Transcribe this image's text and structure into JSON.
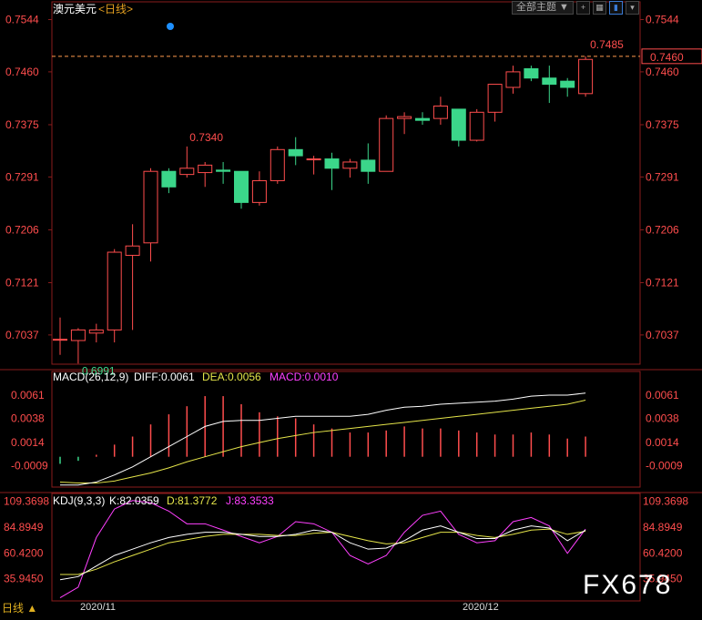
{
  "app": {
    "symbol_label": "澳元美元",
    "period_label": "<日线>",
    "theme_label": "全部主题",
    "corner_period": "日线",
    "watermark": "FX678"
  },
  "colors": {
    "up": "#ff4d4d",
    "down": "#3bd68a",
    "axis_text": "#ff4d4d",
    "grid": "#8a1c1c",
    "diff": "#ffffff",
    "dea": "#e5e54a",
    "macd": "#ff40ff",
    "k": "#ffffff",
    "d": "#e5e54a",
    "j": "#ff40ff",
    "last_price_line": "#ff9a4d",
    "marker_dot": "#1e90ff"
  },
  "chart_data": {
    "type": "candlestick",
    "price_panel": {
      "y_ticks": [
        "0.7544",
        "0.7460",
        "0.7375",
        "0.7291",
        "0.7206",
        "0.7121",
        "0.7037"
      ],
      "ylim": [
        0.699,
        0.7555
      ],
      "high_label": "0.7340",
      "low_label": "0.6991",
      "last_high_label": "0.7485",
      "last_price_label": "0.7460",
      "candles": [
        {
          "o": 0.703,
          "h": 0.7065,
          "l": 0.7005,
          "c": 0.703
        },
        {
          "o": 0.7028,
          "h": 0.7048,
          "l": 0.6991,
          "c": 0.7045
        },
        {
          "o": 0.704,
          "h": 0.7055,
          "l": 0.7025,
          "c": 0.7045
        },
        {
          "o": 0.7045,
          "h": 0.7175,
          "l": 0.7025,
          "c": 0.717
        },
        {
          "o": 0.7165,
          "h": 0.7215,
          "l": 0.7045,
          "c": 0.718
        },
        {
          "o": 0.7185,
          "h": 0.7305,
          "l": 0.7155,
          "c": 0.73
        },
        {
          "o": 0.73,
          "h": 0.7305,
          "l": 0.7265,
          "c": 0.7275
        },
        {
          "o": 0.7295,
          "h": 0.734,
          "l": 0.729,
          "c": 0.7305
        },
        {
          "o": 0.7298,
          "h": 0.7315,
          "l": 0.7275,
          "c": 0.731
        },
        {
          "o": 0.7302,
          "h": 0.7315,
          "l": 0.728,
          "c": 0.73
        },
        {
          "o": 0.73,
          "h": 0.73,
          "l": 0.724,
          "c": 0.725
        },
        {
          "o": 0.725,
          "h": 0.73,
          "l": 0.7245,
          "c": 0.7285
        },
        {
          "o": 0.7285,
          "h": 0.734,
          "l": 0.728,
          "c": 0.7335
        },
        {
          "o": 0.7335,
          "h": 0.7355,
          "l": 0.731,
          "c": 0.7325
        },
        {
          "o": 0.732,
          "h": 0.7325,
          "l": 0.7295,
          "c": 0.732
        },
        {
          "o": 0.732,
          "h": 0.733,
          "l": 0.727,
          "c": 0.7305
        },
        {
          "o": 0.7305,
          "h": 0.732,
          "l": 0.729,
          "c": 0.7315
        },
        {
          "o": 0.7318,
          "h": 0.7345,
          "l": 0.728,
          "c": 0.73
        },
        {
          "o": 0.73,
          "h": 0.739,
          "l": 0.73,
          "c": 0.7385
        },
        {
          "o": 0.7385,
          "h": 0.7395,
          "l": 0.736,
          "c": 0.7388
        },
        {
          "o": 0.7385,
          "h": 0.7395,
          "l": 0.7375,
          "c": 0.7382
        },
        {
          "o": 0.7385,
          "h": 0.742,
          "l": 0.7375,
          "c": 0.7405
        },
        {
          "o": 0.74,
          "h": 0.74,
          "l": 0.734,
          "c": 0.735
        },
        {
          "o": 0.735,
          "h": 0.74,
          "l": 0.7348,
          "c": 0.7395
        },
        {
          "o": 0.7395,
          "h": 0.744,
          "l": 0.738,
          "c": 0.744
        },
        {
          "o": 0.7435,
          "h": 0.747,
          "l": 0.7425,
          "c": 0.746
        },
        {
          "o": 0.7465,
          "h": 0.747,
          "l": 0.7445,
          "c": 0.745
        },
        {
          "o": 0.745,
          "h": 0.747,
          "l": 0.741,
          "c": 0.744
        },
        {
          "o": 0.7445,
          "h": 0.745,
          "l": 0.742,
          "c": 0.7435
        },
        {
          "o": 0.7425,
          "h": 0.7485,
          "l": 0.742,
          "c": 0.748
        }
      ]
    },
    "macd_panel": {
      "header": "MACD(26,12,9)",
      "diff_label": "DIFF:0.0061",
      "dea_label": "DEA:0.0056",
      "macd_label": "MACD:0.0010",
      "y_ticks": [
        "0.0061",
        "0.0038",
        "0.0014",
        "-0.0009"
      ],
      "ylim": [
        -0.003,
        0.007
      ],
      "diff": [
        -0.0028,
        -0.0028,
        -0.0025,
        -0.0018,
        -0.001,
        0.0,
        0.001,
        0.002,
        0.003,
        0.0035,
        0.0036,
        0.0036,
        0.0038,
        0.004,
        0.004,
        0.004,
        0.004,
        0.0042,
        0.0046,
        0.0049,
        0.005,
        0.0052,
        0.0053,
        0.0054,
        0.0055,
        0.0057,
        0.006,
        0.0061,
        0.0061,
        0.0063
      ],
      "dea": [
        -0.0025,
        -0.0026,
        -0.0026,
        -0.0024,
        -0.002,
        -0.0016,
        -0.0011,
        -0.0005,
        0.0,
        0.0005,
        0.001,
        0.0014,
        0.0018,
        0.0021,
        0.0024,
        0.0026,
        0.0028,
        0.003,
        0.0032,
        0.0034,
        0.0036,
        0.0038,
        0.004,
        0.0042,
        0.0044,
        0.0046,
        0.0048,
        0.005,
        0.0052,
        0.0056
      ],
      "macd": [
        -0.0007,
        -0.0004,
        0.0002,
        0.0012,
        0.002,
        0.0032,
        0.0042,
        0.005,
        0.006,
        0.006,
        0.0052,
        0.0044,
        0.004,
        0.0038,
        0.0032,
        0.0028,
        0.0024,
        0.0024,
        0.0026,
        0.003,
        0.0028,
        0.0028,
        0.0026,
        0.0024,
        0.0022,
        0.0022,
        0.0024,
        0.0022,
        0.0018,
        0.002
      ]
    },
    "kdj_panel": {
      "header": "KDJ(9,3,3)",
      "k_label": "K:82.0359",
      "d_label": "D:81.3772",
      "j_label": "J:83.3533",
      "y_ticks": [
        "109.3698",
        "84.8949",
        "60.4200",
        "35.9450"
      ],
      "ylim": [
        15,
        115
      ],
      "k": [
        35,
        38,
        48,
        58,
        64,
        70,
        75,
        78,
        80,
        80,
        78,
        76,
        76,
        78,
        82,
        80,
        70,
        64,
        65,
        72,
        82,
        86,
        80,
        74,
        74,
        82,
        86,
        84,
        72,
        82
      ],
      "d": [
        40,
        40,
        45,
        52,
        58,
        64,
        70,
        73,
        76,
        78,
        78,
        78,
        77,
        77,
        79,
        80,
        76,
        72,
        69,
        70,
        75,
        80,
        80,
        77,
        75,
        78,
        82,
        83,
        78,
        81
      ],
      "j": [
        18,
        28,
        75,
        102,
        110,
        108,
        100,
        88,
        88,
        82,
        76,
        70,
        76,
        90,
        88,
        80,
        58,
        50,
        58,
        80,
        96,
        100,
        78,
        70,
        72,
        90,
        94,
        86,
        60,
        83
      ]
    },
    "x_labels": [
      "2020/11",
      "2020/12"
    ]
  }
}
